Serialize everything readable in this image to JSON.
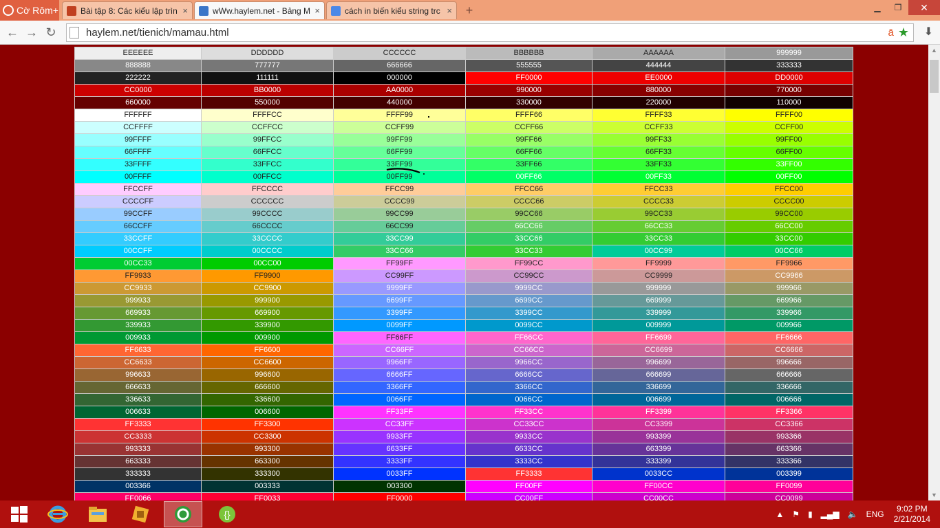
{
  "browser": {
    "brand": "Cờ Rôm+",
    "tabs": [
      {
        "title": "Bài tập 8: Các kiểu lập trìn",
        "fav": "#c04020",
        "active": false
      },
      {
        "title": "wWw.haylem.net - Bảng M",
        "fav": "#3a76c8",
        "active": true
      },
      {
        "title": "cách in biến kiểu string trc",
        "fav": "#4a88e8",
        "active": false
      }
    ],
    "new_tab": "+",
    "window": {
      "minimize": "▁",
      "restore": "❐",
      "close": "✕"
    },
    "toolbar": {
      "back": "←",
      "forward": "→",
      "reload": "↻",
      "url": "haylem.net/tienich/mamau.html",
      "star": "★",
      "ext": "ā",
      "download": "⬇"
    }
  },
  "color_rows": [
    [
      "EEEEEE",
      "DDDDDD",
      "CCCCCC",
      "BBBBBB",
      "AAAAAA",
      "999999"
    ],
    [
      "888888",
      "777777",
      "666666",
      "555555",
      "444444",
      "333333"
    ],
    [
      "222222",
      "111111",
      "000000",
      "FF0000",
      "EE0000",
      "DD0000"
    ],
    [
      "CC0000",
      "BB0000",
      "AA0000",
      "990000",
      "880000",
      "770000"
    ],
    [
      "660000",
      "550000",
      "440000",
      "330000",
      "220000",
      "110000"
    ],
    [
      "FFFFFF",
      "FFFFCC",
      "FFFF99",
      "FFFF66",
      "FFFF33",
      "FFFF00"
    ],
    [
      "CCFFFF",
      "CCFFCC",
      "CCFF99",
      "CCFF66",
      "CCFF33",
      "CCFF00"
    ],
    [
      "99FFFF",
      "99FFCC",
      "99FF99",
      "99FF66",
      "99FF33",
      "99FF00"
    ],
    [
      "66FFFF",
      "66FFCC",
      "66FF99",
      "66FF66",
      "66FF33",
      "66FF00"
    ],
    [
      "33FFFF",
      "33FFCC",
      "33FF99",
      "33FF66",
      "33FF33",
      "33FF00"
    ],
    [
      "00FFFF",
      "00FFCC",
      "00FF99",
      "00FF66",
      "00FF33",
      "00FF00"
    ],
    [
      "FFCCFF",
      "FFCCCC",
      "FFCC99",
      "FFCC66",
      "FFCC33",
      "FFCC00"
    ],
    [
      "CCCCFF",
      "CCCCCC",
      "CCCC99",
      "CCCC66",
      "CCCC33",
      "CCCC00"
    ],
    [
      "99CCFF",
      "99CCCC",
      "99CC99",
      "99CC66",
      "99CC33",
      "99CC00"
    ],
    [
      "66CCFF",
      "66CCCC",
      "66CC99",
      "66CC66",
      "66CC33",
      "66CC00"
    ],
    [
      "33CCFF",
      "33CCCC",
      "33CC99",
      "33CC66",
      "33CC33",
      "33CC00"
    ],
    [
      "00CCFF",
      "00CCCC",
      "33CC66",
      "33CC33",
      "00CC99",
      "00CC66"
    ],
    [
      "00CC33",
      "00CC00",
      "FF99FF",
      "FF99CC",
      "FF9999",
      "FF9966"
    ],
    [
      "FF9933",
      "FF9900",
      "CC99FF",
      "CC99CC",
      "CC9999",
      "CC9966"
    ],
    [
      "CC9933",
      "CC9900",
      "9999FF",
      "9999CC",
      "999999",
      "999966"
    ],
    [
      "999933",
      "999900",
      "6699FF",
      "6699CC",
      "669999",
      "669966"
    ],
    [
      "669933",
      "669900",
      "3399FF",
      "3399CC",
      "339999",
      "339966"
    ],
    [
      "339933",
      "339900",
      "0099FF",
      "0099CC",
      "009999",
      "009966"
    ],
    [
      "009933",
      "009900",
      "FF66FF",
      "FF66CC",
      "FF6699",
      "FF6666"
    ],
    [
      "FF6633",
      "FF6600",
      "CC66FF",
      "CC66CC",
      "CC6699",
      "CC6666"
    ],
    [
      "CC6633",
      "CC6600",
      "9966FF",
      "9966CC",
      "996699",
      "996666"
    ],
    [
      "996633",
      "996600",
      "6666FF",
      "6666CC",
      "666699",
      "666666"
    ],
    [
      "666633",
      "666600",
      "3366FF",
      "3366CC",
      "336699",
      "336666"
    ],
    [
      "336633",
      "336600",
      "0066FF",
      "0066CC",
      "006699",
      "006666"
    ],
    [
      "006633",
      "006600",
      "FF33FF",
      "FF33CC",
      "FF3399",
      "FF3366"
    ],
    [
      "FF3333",
      "FF3300",
      "CC33FF",
      "CC33CC",
      "CC3399",
      "CC3366"
    ],
    [
      "CC3333",
      "CC3300",
      "9933FF",
      "9933CC",
      "993399",
      "993366"
    ],
    [
      "993333",
      "993300",
      "6633FF",
      "6633CC",
      "663399",
      "663366"
    ],
    [
      "663333",
      "663300",
      "3333FF",
      "3333CC",
      "333399",
      "333366"
    ],
    [
      "333333",
      "333300",
      "0033FF",
      "FF3333",
      "0033CC",
      "003399"
    ],
    [
      "003366",
      "003333",
      "003300",
      "FF00FF",
      "FF00CC",
      "FF0099"
    ],
    [
      "FF0066",
      "FF0033",
      "FF0000",
      "CC00FF",
      "CC00CC",
      "CC0099"
    ]
  ],
  "taskbar": {
    "apps": [
      {
        "name": "start-button",
        "active": false
      },
      {
        "name": "ie-icon",
        "active": false
      },
      {
        "name": "file-explorer-icon",
        "active": false
      },
      {
        "name": "box-app-icon",
        "active": false
      },
      {
        "name": "coccoc-browser-icon",
        "active": true
      },
      {
        "name": "code-editor-icon",
        "active": false
      }
    ],
    "tray": {
      "lang": "ENG",
      "time": "9:02 PM",
      "date": "2/21/2014"
    }
  }
}
